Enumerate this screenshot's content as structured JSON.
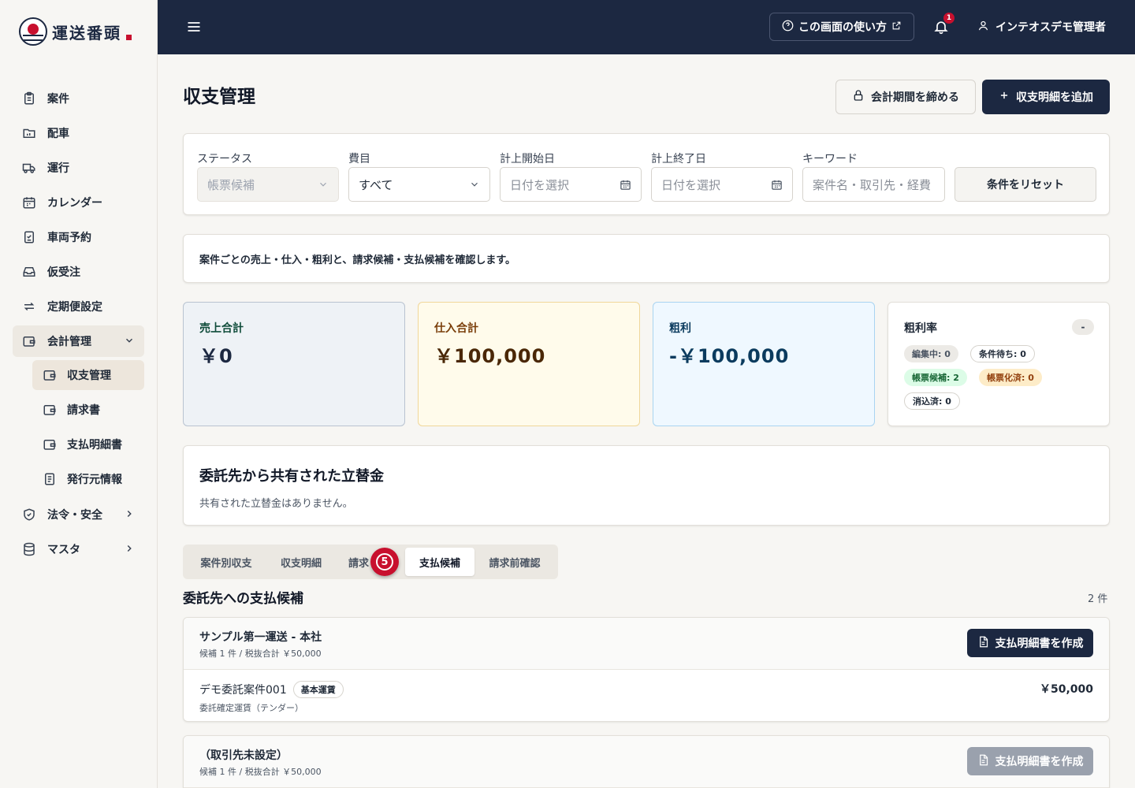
{
  "brand": {
    "name": "運送番頭"
  },
  "nav": {
    "items": [
      {
        "label": "案件",
        "icon": "clipboard-icon"
      },
      {
        "label": "配車",
        "icon": "folder-icon"
      },
      {
        "label": "運行",
        "icon": "truck-icon"
      },
      {
        "label": "カレンダー",
        "icon": "calendar-icon"
      },
      {
        "label": "車両予約",
        "icon": "checklist-icon"
      },
      {
        "label": "仮受注",
        "icon": "inbox-icon"
      },
      {
        "label": "定期便設定",
        "icon": "repeat-icon"
      },
      {
        "label": "会計管理",
        "icon": "wallet-icon",
        "expanded": true
      },
      {
        "label": "法令・安全",
        "icon": "shield-icon"
      },
      {
        "label": "マスタ",
        "icon": "database-icon"
      }
    ],
    "sub_items": [
      {
        "label": "収支管理",
        "active": true
      },
      {
        "label": "請求書"
      },
      {
        "label": "支払明細書"
      },
      {
        "label": "発行元情報"
      }
    ]
  },
  "header": {
    "help_label": "この画面の使い方",
    "notification_count": "1",
    "user_name": "インテオスデモ管理者"
  },
  "page": {
    "title": "収支管理",
    "close_period_label": "会計期間を締める",
    "add_label": "収支明細を追加"
  },
  "filters": {
    "status_label": "ステータス",
    "status_value": "帳票候補",
    "cost_label": "費目",
    "cost_value": "すべて",
    "start_label": "計上開始日",
    "start_placeholder": "日付を選択",
    "end_label": "計上終了日",
    "end_placeholder": "日付を選択",
    "keyword_label": "キーワード",
    "keyword_placeholder": "案件名・取引先・経費",
    "reset_label": "条件をリセット"
  },
  "info_text": "案件ごとの売上・仕入・粗利と、請求候補・支払候補を確認します。",
  "stats": {
    "sales_label": "売上合計",
    "sales_value": "￥0",
    "purchase_label": "仕入合計",
    "purchase_value": "￥100,000",
    "profit_label": "粗利",
    "profit_value": "-￥100,000",
    "rate_label": "粗利率",
    "rate_value": "-",
    "pills": {
      "editing": "編集中: 0",
      "waiting": "条件待ち: 0",
      "candidate": "帳票候補: 2",
      "issued": "帳票化済: 0",
      "cleared": "消込済: 0"
    }
  },
  "advance": {
    "title": "委託先から共有された立替金",
    "empty": "共有された立替金はありません。"
  },
  "tabs": [
    {
      "label": "案件別収支"
    },
    {
      "label": "収支明細"
    },
    {
      "label": "請求"
    },
    {
      "label": "支払候補",
      "active": true
    },
    {
      "label": "請求前確認"
    }
  ],
  "step_marker": "5",
  "section": {
    "title": "委託先への支払候補",
    "count": "2 件"
  },
  "groups": [
    {
      "name": "サンプル第一運送 - 本社",
      "meta": "候補 1 件 / 税抜合計 ￥50,000",
      "button": "支払明細書を作成",
      "rows": [
        {
          "name": "デモ委託案件001",
          "tag": "基本運賃",
          "sub": "委託確定運賃（テンダー）",
          "amount": "￥50,000"
        }
      ]
    },
    {
      "name": "（取引先未設定）",
      "meta": "候補 1 件 / 税抜合計 ￥50,000",
      "button": "支払明細書を作成"
    }
  ],
  "colors": {
    "navy": "#1c2841",
    "accent_red": "#c8102e",
    "background": "#f7f6f3"
  }
}
